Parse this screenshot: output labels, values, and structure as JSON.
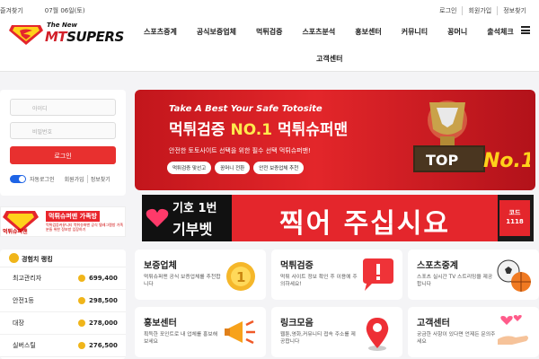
{
  "topbar": {
    "left": [
      "즐겨찾기",
      "07월 06일(토)"
    ],
    "right": [
      "로그인",
      "회원가입",
      "정보찾기"
    ]
  },
  "logo": {
    "new": "The New",
    "brand_red": "MT",
    "brand_dark": "SUPERS"
  },
  "nav": [
    "스포츠중계",
    "공식보증업체",
    "먹튀검증",
    "스포츠분석",
    "홍보센터",
    "커뮤니티",
    "꽁머니",
    "출석체크"
  ],
  "nav2": "고객센터",
  "login": {
    "id_placeholder": "아이디",
    "pw_placeholder": "비밀번호",
    "button": "로그인",
    "auto_login": "자동로그인",
    "links": [
      "회원가입",
      "정보찾기"
    ]
  },
  "minibanner": {
    "logo_text": "먹튀슈퍼맨",
    "title": "먹튀슈퍼맨 가족방",
    "sub": "먹튀검증커뮤니티 먹튀슈퍼맨 공식 텔레그램방 가족분들 위한 정보방 입장하기"
  },
  "ranking": {
    "title": "경험치 랭킹",
    "rows": [
      {
        "name": "최고관리자",
        "points": "699,400"
      },
      {
        "name": "안전1등",
        "points": "298,500"
      },
      {
        "name": "대장",
        "points": "278,000"
      },
      {
        "name": "실버스틸",
        "points": "276,500"
      }
    ]
  },
  "hero": {
    "tag": "Take A Best Your Safe Totosite",
    "title_a": "먹튀검증 ",
    "title_b": "NO.1",
    "title_c": " 먹튀슈퍼맨",
    "desc": "안전한 토토사이트 선택을 위한 필수 선택 먹튀슈퍼맨!",
    "chips": [
      "먹튀검증 맞선고",
      "꽁머니 전환",
      "안전 보증업체 추천"
    ],
    "trophy_text": "TOP",
    "trophy_no": "No.1"
  },
  "ad": {
    "line1": "기호 1번",
    "line2": "기부벳",
    "big": "찍어 주십시요",
    "code_label": "코드",
    "code": "1118"
  },
  "cards": [
    {
      "title": "보증업체",
      "desc": "먹튀슈퍼맨 공식 보증업체를 추천합니다",
      "icon": "number-one-badge-icon"
    },
    {
      "title": "먹튀검증",
      "desc": "먹튀 사이트 정보 확인 후 이용에 주의하세요!",
      "icon": "alert-bubble-icon"
    },
    {
      "title": "스포츠중계",
      "desc": "스포츠 실시간 TV 스트리밍을 제공합니다",
      "icon": "sports-balls-icon"
    },
    {
      "title": "홍보센터",
      "desc": "획득한 포인트로 내 업체를 홍보해 보세요",
      "icon": "megaphone-icon"
    },
    {
      "title": "링크모음",
      "desc": "웹툰,영화,커뮤니티 접속 주소를 제공합니다",
      "icon": "map-pin-icon"
    },
    {
      "title": "고객센터",
      "desc": "궁금한 사항이 있다면 언제든 문의주세요",
      "icon": "heart-hand-icon"
    }
  ],
  "colors": {
    "brand_red": "#e4262c",
    "accent_blue": "#1e64e6",
    "gold": "#f0b51a"
  }
}
